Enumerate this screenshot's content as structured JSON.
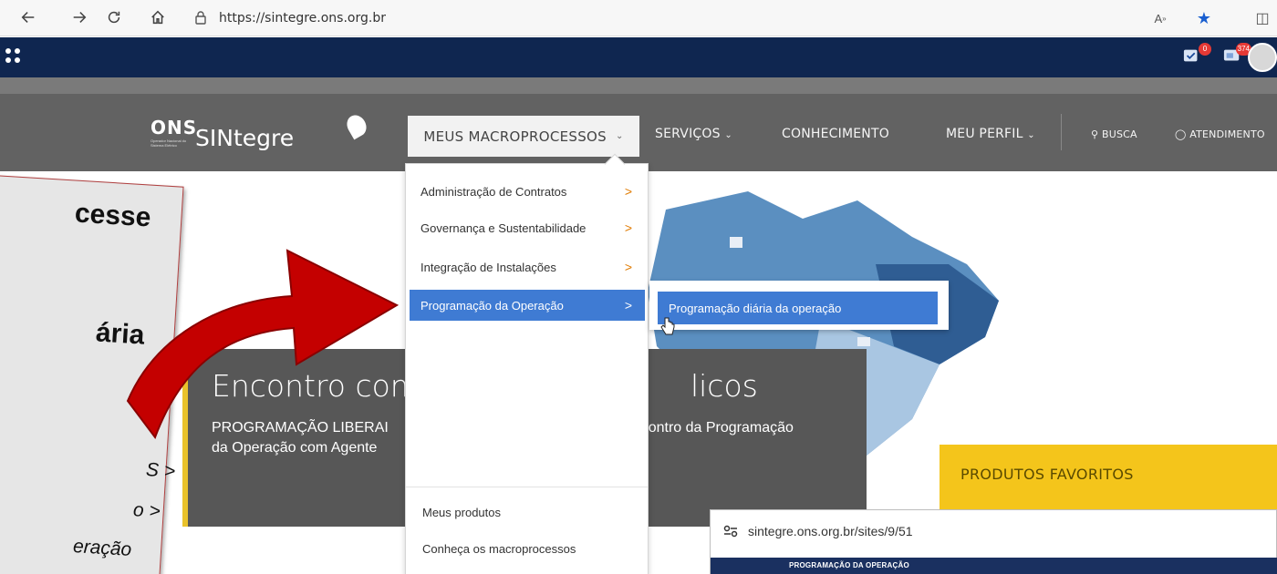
{
  "browser": {
    "url": "https://sintegre.ons.org.br"
  },
  "appbar": {
    "badge_tasks": "0",
    "badge_messages": "374"
  },
  "site": {
    "logo_ons": "ONS",
    "logo_ons_sub": "Operador Nacional do Sistema Elétrico",
    "logo_sintegre": "SINtegre",
    "nav": {
      "macroprocessos": "MEUS MACROPROCESSOS",
      "servicos": "SERVIÇOS",
      "conhecimento": "CONHECIMENTO",
      "perfil": "MEU PERFIL",
      "busca": "BUSCA",
      "atendimento": "ATENDIMENTO"
    },
    "dropdown": {
      "items": [
        "Administração de Contratos",
        "Governança e Sustentabilidade",
        "Integração de Instalações",
        "Programação da Operação"
      ],
      "footer": [
        "Meus produtos",
        "Conheça os macroprocessos"
      ]
    },
    "submenu": {
      "item": "Programação diária da operação"
    },
    "news": {
      "title_left": "Encontro com",
      "title_right": "licos",
      "body_left_1": "PROGRAMAÇÃO LIBERAI",
      "body_right_1": "ncontro da Programação",
      "body_2": "da Operação com Agente"
    },
    "favorites": {
      "title": "PRODUTOS FAVORITOS"
    }
  },
  "inset": {
    "url": "sintegre.ons.org.br/sites/9/51",
    "bar_text": "PROGRAMAÇÃO DA OPERAÇÃO"
  },
  "note": {
    "line1": "cesse",
    "line2": "ária",
    "sub1": "S >",
    "sub2": "o >",
    "sub3": "eração"
  },
  "colors": {
    "appbar": "#0f2650",
    "accent_blue": "#3f7bd3",
    "header_grey": "#626262",
    "news_accent": "#e9c22b",
    "favorites": "#f4c51b",
    "arrow": "#c40000"
  }
}
